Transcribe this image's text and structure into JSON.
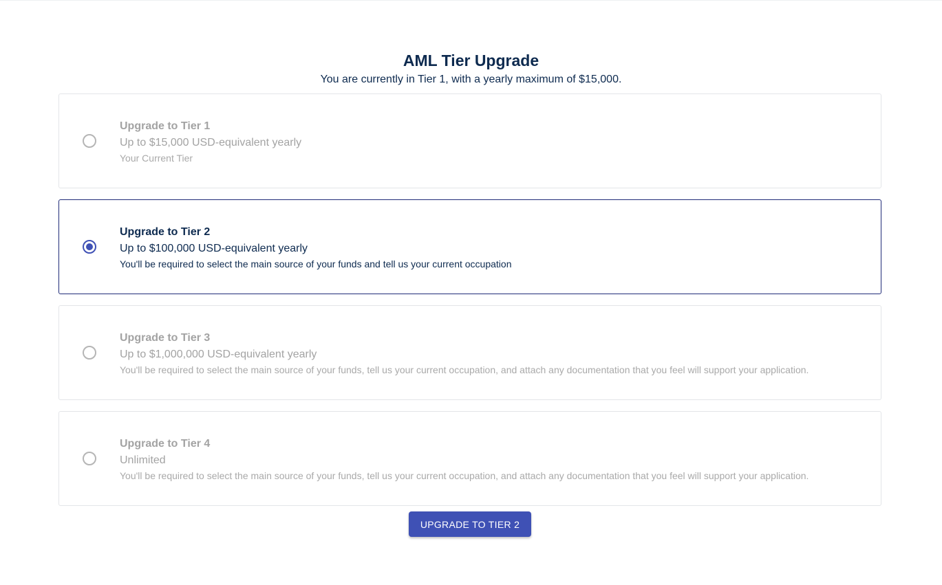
{
  "header": {
    "title": "AML Tier Upgrade",
    "subtitle": "You are currently in Tier 1, with a yearly maximum of $15,000."
  },
  "tiers": [
    {
      "title": "Upgrade to Tier 1",
      "limit": "Up to $15,000 USD-equivalent yearly",
      "note": "Your Current Tier",
      "selected": false,
      "disabled": true
    },
    {
      "title": "Upgrade to Tier 2",
      "limit": "Up to $100,000 USD-equivalent yearly",
      "note": "You'll be required to select the main source of your funds and tell us your current occupation",
      "selected": true,
      "disabled": false
    },
    {
      "title": "Upgrade to Tier 3",
      "limit": "Up to $1,000,000 USD-equivalent yearly",
      "note": "You'll be required to select the main source of your funds, tell us your current occupation, and attach any documentation that you feel will support your application.",
      "selected": false,
      "disabled": true
    },
    {
      "title": "Upgrade to Tier 4",
      "limit": "Unlimited",
      "note": "You'll be required to select the main source of your funds, tell us your current occupation, and attach any documentation that you feel will support your application.",
      "selected": false,
      "disabled": true
    }
  ],
  "actions": {
    "upgrade_label": "UPGRADE TO TIER 2"
  },
  "colors": {
    "accent": "#3f51b5",
    "text_primary": "#0d2a4f",
    "text_disabled": "#a3a3a3",
    "selected_border": "#1f2a78"
  }
}
